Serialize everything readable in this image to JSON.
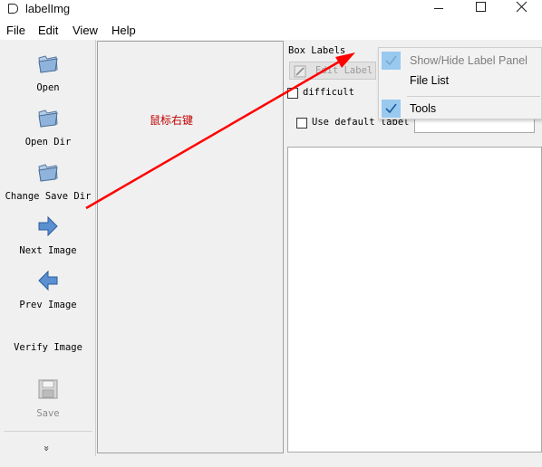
{
  "window": {
    "title": "labelImg",
    "icons": {
      "app": "app-icon",
      "minimize": "minimize-icon",
      "maximize": "maximize-icon",
      "close": "close-icon"
    }
  },
  "menu": {
    "file": "File",
    "edit": "Edit",
    "view": "View",
    "help": "Help"
  },
  "toolbar": {
    "open": "Open",
    "open_dir": "Open Dir",
    "change_save_dir": "Change Save Dir",
    "next_image": "Next Image",
    "prev_image": "Prev Image",
    "verify_image": "Verify Image",
    "save": "Save",
    "more": "»",
    "icons": [
      "folder-icon",
      "folder-icon",
      "folder-icon",
      "arrow-right-icon",
      "arrow-left-icon",
      "floppy-disk-icon",
      "chevron-double-down-icon"
    ]
  },
  "canvas": {
    "annotation": "鼠标右键"
  },
  "dock": {
    "title": "Box Labels",
    "edit_label": "Edit Label",
    "difficult": "difficult",
    "use_default_label": "Use default label",
    "default_label_value": ""
  },
  "context_menu": {
    "show_hide_label_panel": "Show/Hide Label Panel",
    "file_list": "File List",
    "tools": "Tools"
  },
  "colors": {
    "arrow": "#ff0000",
    "annotation": "#c00000",
    "check_highlight": "#99c9ef",
    "check_mark": "#1e5aa0"
  }
}
